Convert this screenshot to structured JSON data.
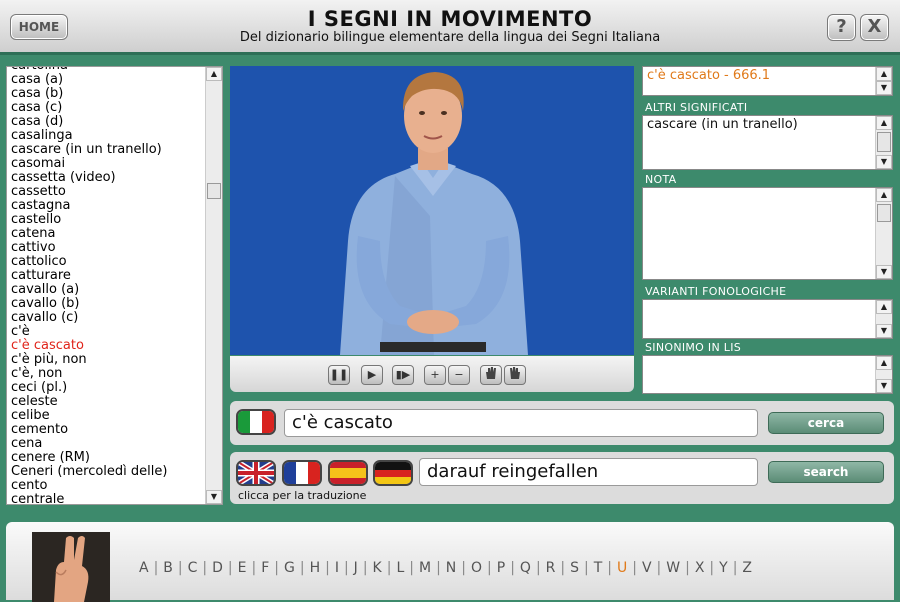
{
  "header": {
    "home_label": "HOME",
    "title": "I SEGNI IN MOVIMENTO",
    "subtitle": "Del dizionario bilingue elementare della lingua dei Segni Italiana",
    "help_label": "?",
    "close_label": "X"
  },
  "word_list": {
    "items": [
      "cartolina",
      "casa (a)",
      "casa (b)",
      "casa (c)",
      "casa (d)",
      "casalinga",
      "cascare (in un tranello)",
      "casomai",
      "cassetta (video)",
      "cassetto",
      "castagna",
      "castello",
      "catena",
      "cattivo",
      "cattolico",
      "catturare",
      "cavallo (a)",
      "cavallo (b)",
      "cavallo (c)",
      "c'è",
      "c'è cascato",
      "c'è più, non",
      "c'è, non",
      "ceci (pl.)",
      "celeste",
      "celibe",
      "cemento",
      "cena",
      "cenere (RM)",
      "Ceneri (mercoledì delle)",
      "cento",
      "centrale"
    ],
    "selected": "c'è cascato"
  },
  "video_controls": {
    "pause": "❚❚",
    "play": "▶",
    "step": "▮▶",
    "zoom_in": "+",
    "zoom_out": "−"
  },
  "details": {
    "entry": "c'è cascato - 666.1",
    "altri_label": "ALTRI SIGNIFICATI",
    "altri_value": "cascare (in un tranello)",
    "nota_label": "NOTA",
    "nota_value": "",
    "varianti_label": "VARIANTI FONOLOGICHE",
    "varianti_value": "",
    "sinonimo_label": "SINONIMO IN LIS",
    "sinonimo_value": ""
  },
  "search": {
    "value": "c'è cascato",
    "button": "cerca"
  },
  "translation": {
    "value": "darauf reingefallen",
    "button": "search",
    "hint": "clicca per la traduzione"
  },
  "alphabet": {
    "letters": [
      "A",
      "B",
      "C",
      "D",
      "E",
      "F",
      "G",
      "H",
      "I",
      "J",
      "K",
      "L",
      "M",
      "N",
      "O",
      "P",
      "Q",
      "R",
      "S",
      "T",
      "U",
      "V",
      "W",
      "X",
      "Y",
      "Z"
    ],
    "current": "U"
  },
  "colors": {
    "accent_green": "#3d8a6c",
    "selected_red": "#e0241a",
    "entry_orange": "#e07a1a"
  }
}
